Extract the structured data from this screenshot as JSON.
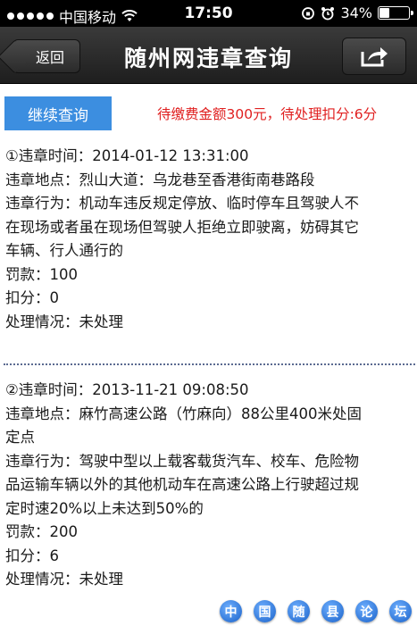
{
  "status_bar": {
    "carrier": "中国移动",
    "time": "17:50",
    "battery": "34%",
    "battery_level": 0.34
  },
  "nav": {
    "back_label": "返回",
    "title": "随州网违章查询"
  },
  "actions": {
    "continue_label": "继续查询",
    "summary": "待缴费金额300元，待处理扣分:6分"
  },
  "records": [
    {
      "time": "①违章时间：2014-01-12 13:31:00",
      "location": "违章地点：烈山大道：乌龙巷至香港街南巷路段",
      "behavior_lines": [
        "违章行为：机动车违反规定停放、临时停车且驾驶人不",
        "在现场或者虽在现场但驾驶人拒绝立即驶离，妨碍其它",
        "车辆、行人通行的"
      ],
      "fine": "罚款：100",
      "points": "扣分：0",
      "status": "处理情况：未处理"
    },
    {
      "time": "②违章时间：2013-11-21 09:08:50",
      "location_lines": [
        "违章地点：麻竹高速公路（竹麻向）88公里400米处固",
        "定点"
      ],
      "behavior_lines": [
        "违章行为：驾驶中型以上载客载货汽车、校车、危险物",
        "品运输车辆以外的其他机动车在高速公路上行驶超过规",
        "定时速20%以上未达到50%的"
      ],
      "fine": "罚款：200",
      "points": "扣分：6",
      "status": "处理情况：未处理"
    }
  ],
  "watermark": [
    "中",
    "国",
    "随",
    "县",
    "论",
    "坛"
  ]
}
